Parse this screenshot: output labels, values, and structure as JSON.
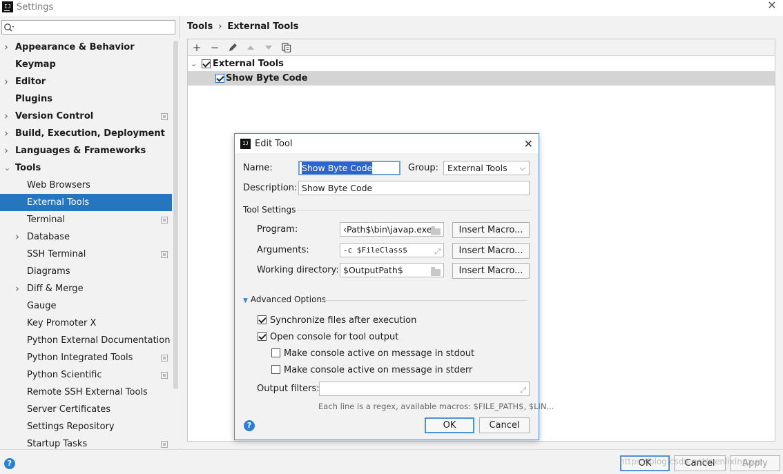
{
  "window": {
    "title": "Settings",
    "app_icon_text": "IJ"
  },
  "search": {
    "placeholder": ""
  },
  "sidebar": {
    "items": [
      {
        "label": "Appearance & Behavior",
        "bold": true,
        "arrow": true,
        "level": 0
      },
      {
        "label": "Keymap",
        "bold": true,
        "arrow": false,
        "level": 0
      },
      {
        "label": "Editor",
        "bold": true,
        "arrow": true,
        "level": 0
      },
      {
        "label": "Plugins",
        "bold": true,
        "arrow": false,
        "level": 0
      },
      {
        "label": "Version Control",
        "bold": true,
        "arrow": true,
        "level": 0,
        "copy": true
      },
      {
        "label": "Build, Execution, Deployment",
        "bold": true,
        "arrow": true,
        "level": 0
      },
      {
        "label": "Languages & Frameworks",
        "bold": true,
        "arrow": true,
        "level": 0
      },
      {
        "label": "Tools",
        "bold": true,
        "arrow": "open",
        "level": 0
      },
      {
        "label": "Web Browsers",
        "level": 1
      },
      {
        "label": "External Tools",
        "level": 1,
        "selected": true
      },
      {
        "label": "Terminal",
        "level": 1,
        "copy": true
      },
      {
        "label": "Database",
        "level": 1,
        "arrow": true
      },
      {
        "label": "SSH Terminal",
        "level": 1,
        "copy": true
      },
      {
        "label": "Diagrams",
        "level": 1
      },
      {
        "label": "Diff & Merge",
        "level": 1,
        "arrow": true
      },
      {
        "label": "Gauge",
        "level": 1
      },
      {
        "label": "Key Promoter X",
        "level": 1
      },
      {
        "label": "Python External Documentation",
        "level": 1
      },
      {
        "label": "Python Integrated Tools",
        "level": 1,
        "copy": true
      },
      {
        "label": "Python Scientific",
        "level": 1,
        "copy": true
      },
      {
        "label": "Remote SSH External Tools",
        "level": 1
      },
      {
        "label": "Server Certificates",
        "level": 1
      },
      {
        "label": "Settings Repository",
        "level": 1
      },
      {
        "label": "Startup Tasks",
        "level": 1,
        "copy": true
      }
    ]
  },
  "breadcrumb": {
    "parent": "Tools",
    "separator": "›",
    "current": "External Tools"
  },
  "toolbar": {
    "add": "+",
    "remove": "−",
    "edit_icon": "pencil-icon",
    "up_icon": "arrow-up-icon",
    "down_icon": "arrow-down-icon",
    "copy_icon": "copy-icon"
  },
  "tools_tree": {
    "group_label": "External Tools",
    "group_checked": true,
    "tool_label": "Show Byte Code",
    "tool_checked": true
  },
  "dialog": {
    "title": "Edit Tool",
    "name_label": "Name:",
    "name_value": "Show Byte Code",
    "group_label": "Group:",
    "group_value": "External Tools",
    "description_label": "Description:",
    "description_value": "Show Byte Code",
    "tool_settings_label": "Tool Settings",
    "program_label": "Program:",
    "program_value": "‹Path$\\bin\\javap.exe",
    "arguments_label": "Arguments:",
    "arguments_value": "-c $FileClass$",
    "working_dir_label": "Working directory:",
    "working_dir_value": "$OutputPath$",
    "insert_macro_label": "Insert Macro...",
    "advanced_label": "Advanced Options",
    "sync_label": "Synchronize files after execution",
    "sync_checked": true,
    "console_label": "Open console for tool output",
    "console_checked": true,
    "stdout_label": "Make console active on message in stdout",
    "stdout_checked": false,
    "stderr_label": "Make console active on message in stderr",
    "stderr_checked": false,
    "output_filters_label": "Output filters:",
    "output_filters_value": "",
    "hint": "Each line is a regex, available macros: $FILE_PATH$, $LIN...",
    "ok_label": "OK",
    "cancel_label": "Cancel"
  },
  "footer": {
    "ok_label": "OK",
    "cancel_label": "Cancel",
    "apply_label": "Apply",
    "watermark": "https://blog.csdn.net/wenlixingxue"
  },
  "colors": {
    "selection": "#2675bf",
    "accent": "#4f8fd6",
    "help": "#2b7fd4"
  }
}
